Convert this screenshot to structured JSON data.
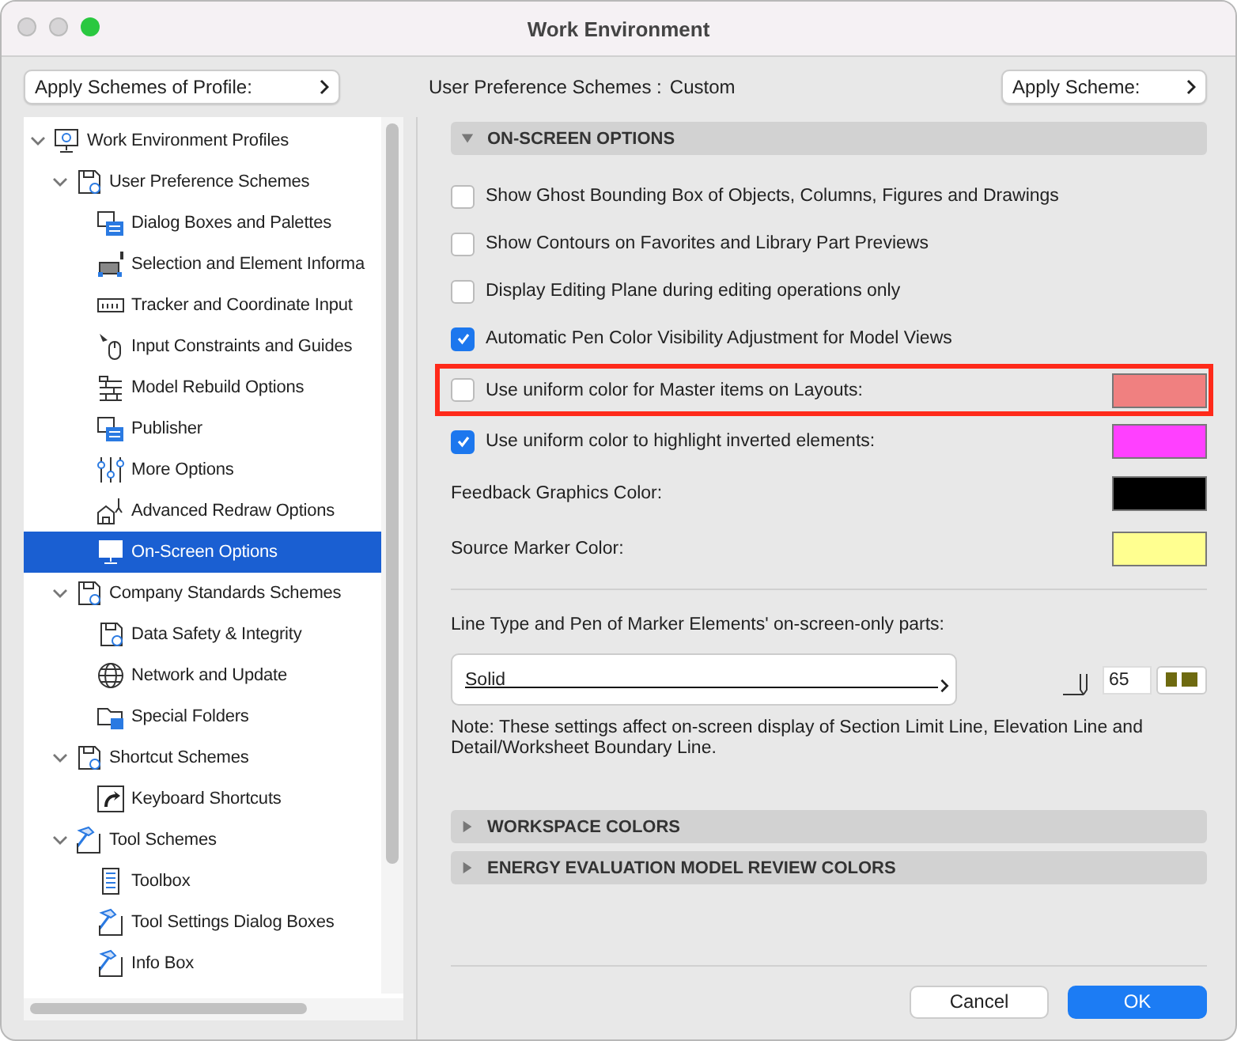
{
  "window": {
    "title": "Work Environment"
  },
  "toolbar": {
    "profile_button": "Apply Schemes of Profile:",
    "scheme_label": "User Preference Schemes :",
    "scheme_value": "Custom",
    "scheme_button": "Apply Scheme:"
  },
  "tree": [
    {
      "label": "Work Environment Profiles",
      "expanded": true,
      "selected": false,
      "children": [
        {
          "label": "User Preference Schemes",
          "expanded": true,
          "selected": false,
          "children": [
            {
              "label": "Dialog Boxes and Palettes",
              "selected": false
            },
            {
              "label": "Selection and Element Informa",
              "selected": false
            },
            {
              "label": "Tracker and Coordinate Input",
              "selected": false
            },
            {
              "label": "Input Constraints and Guides",
              "selected": false
            },
            {
              "label": "Model Rebuild Options",
              "selected": false
            },
            {
              "label": "Publisher",
              "selected": false
            },
            {
              "label": "More Options",
              "selected": false
            },
            {
              "label": "Advanced Redraw Options",
              "selected": false
            },
            {
              "label": "On-Screen Options",
              "selected": true
            }
          ]
        },
        {
          "label": "Company Standards Schemes",
          "expanded": true,
          "selected": false,
          "children": [
            {
              "label": "Data Safety & Integrity",
              "selected": false
            },
            {
              "label": "Network and Update",
              "selected": false
            },
            {
              "label": "Special Folders",
              "selected": false
            }
          ]
        },
        {
          "label": "Shortcut Schemes",
          "expanded": true,
          "selected": false,
          "children": [
            {
              "label": "Keyboard Shortcuts",
              "selected": false
            }
          ]
        },
        {
          "label": "Tool Schemes",
          "expanded": true,
          "selected": false,
          "children": [
            {
              "label": "Toolbox",
              "selected": false
            },
            {
              "label": "Tool Settings Dialog Boxes",
              "selected": false
            },
            {
              "label": "Info Box",
              "selected": false
            }
          ]
        }
      ]
    }
  ],
  "sections": [
    {
      "title": "ON-SCREEN OPTIONS",
      "expanded": true
    },
    {
      "title": "WORKSPACE COLORS",
      "expanded": false
    },
    {
      "title": "ENERGY EVALUATION MODEL REVIEW COLORS",
      "expanded": false
    }
  ],
  "options": [
    {
      "kind": "checkbox",
      "label": "Show Ghost Bounding Box of Objects, Columns, Figures and Drawings",
      "checked": false
    },
    {
      "kind": "checkbox",
      "label": "Show Contours on Favorites and Library Part Previews",
      "checked": false
    },
    {
      "kind": "checkbox",
      "label": "Display Editing Plane during editing operations only",
      "checked": false
    },
    {
      "kind": "checkbox",
      "label": "Automatic Pen Color Visibility Adjustment for Model Views",
      "checked": true
    },
    {
      "kind": "checkbox-color",
      "label": "Use uniform color for Master items on Layouts:",
      "checked": false,
      "color": "#f08080",
      "highlighted": true
    },
    {
      "kind": "checkbox-color",
      "label": "Use uniform color to highlight inverted elements:",
      "checked": true,
      "color": "#ff40ff",
      "highlighted": false
    },
    {
      "kind": "color",
      "label": "Feedback Graphics Color:",
      "color": "#000000"
    },
    {
      "kind": "color",
      "label": "Source Marker Color:",
      "color": "#ffff90"
    }
  ],
  "marker": {
    "label": "Line Type and Pen of Marker Elements' on-screen-only parts:",
    "line_type": "Solid",
    "pen": "65",
    "note": "Note: These settings affect on-screen display of Section Limit Line, Elevation Line and Detail/Worksheet Boundary Line."
  },
  "buttons": [
    {
      "label": "Cancel",
      "default": false
    },
    {
      "label": "OK",
      "default": true
    }
  ]
}
